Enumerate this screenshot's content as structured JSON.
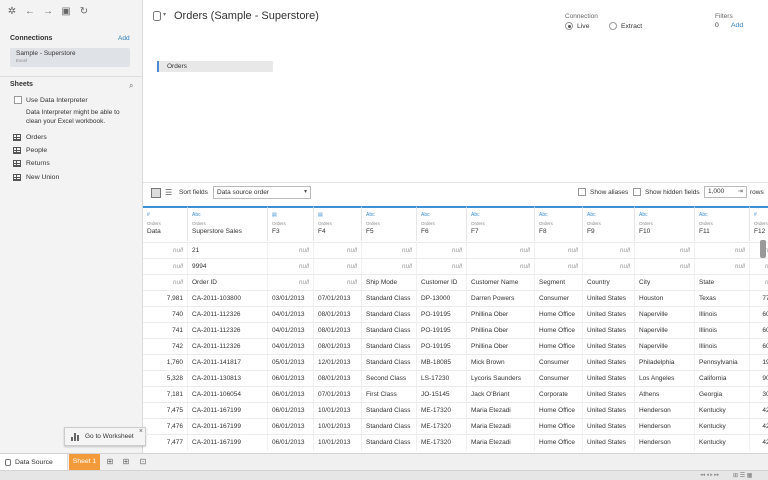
{
  "header": {
    "title": "Orders (Sample - Superstore)",
    "connection_label": "Connection",
    "live_label": "Live",
    "extract_label": "Extract",
    "filters_label": "Filters",
    "filters_count": "0",
    "filters_add": "Add",
    "canvas_table": "Orders"
  },
  "sidebar": {
    "connections_title": "Connections",
    "connections_add": "Add",
    "connection_name": "Sample - Superstore",
    "connection_type": "Excel",
    "sheets_title": "Sheets",
    "data_interpreter_label": "Use Data Interpreter",
    "data_interpreter_note": "Data Interpreter might be able to clean your Excel workbook.",
    "sheets": [
      {
        "label": "Orders"
      },
      {
        "label": "People"
      },
      {
        "label": "Returns"
      }
    ],
    "new_union": "New Union"
  },
  "tooltip": {
    "label": "Go to Worksheet",
    "close": "×"
  },
  "grid_toolbar": {
    "sort_label": "Sort fields",
    "sort_value": "Data source order",
    "show_aliases": "Show aliases",
    "show_hidden": "Show hidden fields",
    "rows_value": "1,000",
    "rows_label": "rows"
  },
  "columns": [
    {
      "type": "#",
      "source": "Orders",
      "name": "Data"
    },
    {
      "type": "Abc",
      "source": "Orders",
      "name": "Superstore Sales"
    },
    {
      "type": "date",
      "source": "Orders",
      "name": "F3"
    },
    {
      "type": "date",
      "source": "Orders",
      "name": "F4"
    },
    {
      "type": "Abc",
      "source": "Orders",
      "name": "F5"
    },
    {
      "type": "Abc",
      "source": "Orders",
      "name": "F6"
    },
    {
      "type": "Abc",
      "source": "Orders",
      "name": "F7"
    },
    {
      "type": "Abc",
      "source": "Orders",
      "name": "F8"
    },
    {
      "type": "Abc",
      "source": "Orders",
      "name": "F9"
    },
    {
      "type": "Abc",
      "source": "Orders",
      "name": "F10"
    },
    {
      "type": "Abc",
      "source": "Orders",
      "name": "F11"
    },
    {
      "type": "#",
      "source": "Orders",
      "name": "F12"
    }
  ],
  "rows": [
    [
      "null",
      "21",
      "null",
      "null",
      "null",
      "null",
      "null",
      "null",
      "null",
      "null",
      "null",
      "null"
    ],
    [
      "null",
      "9994",
      "null",
      "null",
      "null",
      "null",
      "null",
      "null",
      "null",
      "null",
      "null",
      "null"
    ],
    [
      "null",
      "Order ID",
      "null",
      "null",
      "Ship Mode",
      "Customer ID",
      "Customer Name",
      "Segment",
      "Country",
      "City",
      "State",
      "null"
    ],
    [
      "7,981",
      "CA-2011-103800",
      "03/01/2013",
      "07/01/2013",
      "Standard Class",
      "DP-13000",
      "Darren Powers",
      "Consumer",
      "United States",
      "Houston",
      "Texas",
      "77,0"
    ],
    [
      "740",
      "CA-2011-112326",
      "04/01/2013",
      "08/01/2013",
      "Standard Class",
      "PO-19195",
      "Phillina Ober",
      "Home Office",
      "United States",
      "Naperville",
      "Illinois",
      "60,5"
    ],
    [
      "741",
      "CA-2011-112326",
      "04/01/2013",
      "08/01/2013",
      "Standard Class",
      "PO-19195",
      "Phillina Ober",
      "Home Office",
      "United States",
      "Naperville",
      "Illinois",
      "60,5"
    ],
    [
      "742",
      "CA-2011-112326",
      "04/01/2013",
      "08/01/2013",
      "Standard Class",
      "PO-19195",
      "Phillina Ober",
      "Home Office",
      "United States",
      "Naperville",
      "Illinois",
      "60,5"
    ],
    [
      "1,760",
      "CA-2011-141817",
      "05/01/2013",
      "12/01/2013",
      "Standard Class",
      "MB-18085",
      "Mick Brown",
      "Consumer",
      "United States",
      "Philadelphia",
      "Pennsylvania",
      "19,1"
    ],
    [
      "5,328",
      "CA-2011-130813",
      "06/01/2013",
      "08/01/2013",
      "Second Class",
      "LS-17230",
      "Lycoris Saunders",
      "Consumer",
      "United States",
      "Los Angeles",
      "California",
      "90,0"
    ],
    [
      "7,181",
      "CA-2011-106054",
      "06/01/2013",
      "07/01/2013",
      "First Class",
      "JO-15145",
      "Jack O'Briant",
      "Corporate",
      "United States",
      "Athens",
      "Georgia",
      "30,6"
    ],
    [
      "7,475",
      "CA-2011-167199",
      "06/01/2013",
      "10/01/2013",
      "Standard Class",
      "ME-17320",
      "Maria Etezadi",
      "Home Office",
      "United States",
      "Henderson",
      "Kentucky",
      "42,4"
    ],
    [
      "7,476",
      "CA-2011-167199",
      "06/01/2013",
      "10/01/2013",
      "Standard Class",
      "ME-17320",
      "Maria Etezadi",
      "Home Office",
      "United States",
      "Henderson",
      "Kentucky",
      "42,4"
    ],
    [
      "7,477",
      "CA-2011-167199",
      "06/01/2013",
      "10/01/2013",
      "Standard Class",
      "ME-17320",
      "Maria Etezadi",
      "Home Office",
      "United States",
      "Henderson",
      "Kentucky",
      "42,4"
    ]
  ],
  "bottom": {
    "data_source_tab": "Data Source",
    "sheet_tab": "Sheet 1"
  },
  "colors": {
    "accent": "#3d8fd6",
    "sheet_tab": "#f39b3a",
    "link": "#2a7dc0"
  }
}
